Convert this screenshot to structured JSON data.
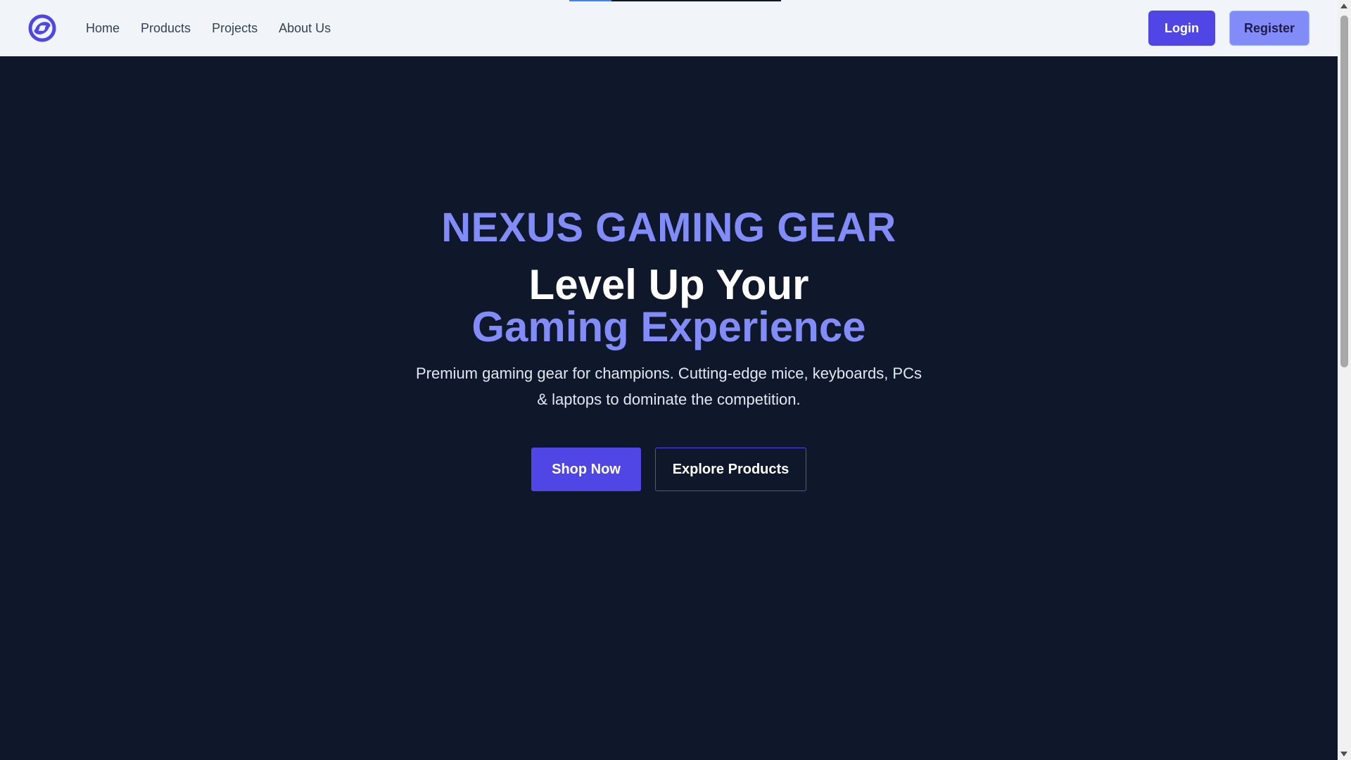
{
  "navbar": {
    "logo_icon": "swirl-logo-icon",
    "links": [
      "Home",
      "Products",
      "Projects",
      "About Us"
    ],
    "login_label": "Login",
    "register_label": "Register"
  },
  "hero": {
    "brand": "NEXUS GAMING GEAR",
    "headline_line1": "Level Up Your",
    "headline_line2": "Gaming Experience",
    "description": "Premium gaming gear for champions. Cutting-edge mice, keyboards, PCs & laptops to dominate the competition.",
    "primary_cta": "Shop Now",
    "secondary_cta": "Explore Products"
  },
  "colors": {
    "background": "#0f172a",
    "navbar": "#f1f5f9",
    "accent": "#4f46e5",
    "accent_light": "#818cf8",
    "text": "#ffffff"
  }
}
